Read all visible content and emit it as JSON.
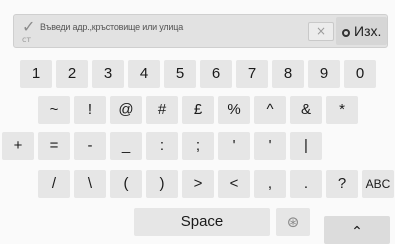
{
  "input": {
    "placeholder": "Въведи адр.,кръстовище или улица",
    "check_icon": "✓",
    "cursor_mark": "ст",
    "clear_label": "×",
    "exit_label": "Изх."
  },
  "rows": [
    [
      "1",
      "2",
      "3",
      "4",
      "5",
      "6",
      "7",
      "8",
      "9",
      "0"
    ],
    [
      "~",
      "!",
      "@",
      "#",
      "£",
      "%",
      "^",
      "&",
      "*"
    ],
    [
      "+",
      "=",
      "-",
      "_",
      ":",
      ";",
      "'",
      "'",
      "|"
    ],
    [
      "/",
      "\\",
      "(",
      ")",
      ">",
      "<",
      ",",
      ".",
      "?",
      "ABC"
    ]
  ],
  "bottom": {
    "space_label": "Space",
    "globe_icon": "⊛",
    "caret_icon": "⌃"
  }
}
